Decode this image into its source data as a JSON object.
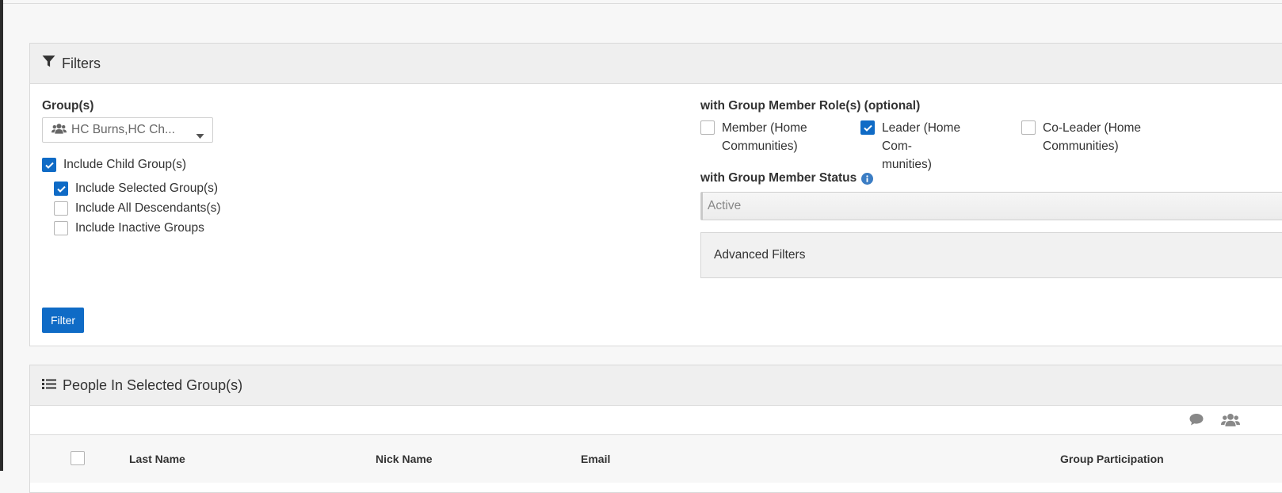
{
  "filters": {
    "title": "Filters",
    "groups_label": "Group(s)",
    "groups_value": "HC Burns,HC Ch...",
    "include_child": {
      "label": "Include Child Group(s)",
      "checked": true
    },
    "include_selected": {
      "label": "Include Selected Group(s)",
      "checked": true
    },
    "include_descendants": {
      "label": "Include All Descendants(s)",
      "checked": false
    },
    "include_inactive": {
      "label": "Include Inactive Groups",
      "checked": false
    },
    "roles_label": "with Group Member Role(s) (optional)",
    "roles": [
      {
        "line1": "Member (Home",
        "line2": "Communities)",
        "checked": false
      },
      {
        "line1": "Leader (Home Com-",
        "line2": "munities)",
        "checked": true
      },
      {
        "line1": "Co-Leader (Home",
        "line2": "Communities)",
        "checked": false
      }
    ],
    "status_label": "with Group Member Status",
    "status_value": "Active",
    "advanced_label": "Advanced Filters",
    "filter_button": "Filter"
  },
  "people": {
    "title": "People In Selected Group(s)",
    "columns": [
      "Last Name",
      "Nick Name",
      "Email",
      "Group Participation"
    ]
  },
  "colors": {
    "primary": "#0f6bc6",
    "info": "#3b7dc4"
  },
  "icons": [
    "filter-icon",
    "users-icon",
    "caret-down-icon",
    "check-icon",
    "info-icon",
    "list-icon",
    "comment-icon"
  ]
}
